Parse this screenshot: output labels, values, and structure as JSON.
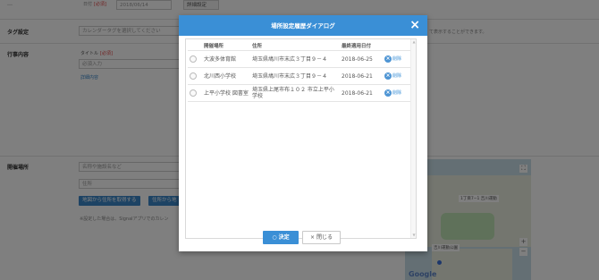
{
  "background": {
    "top_label": "日付",
    "top_required": "[必須]",
    "top_date": "2018/06/14",
    "top_button": "詳細設定",
    "tag_label": "タグ設定",
    "tag_placeholder": "カレンダータグを選択してください",
    "tag_note": "て表示することができます。",
    "event_label": "行事内容",
    "title_label": "タイトル",
    "title_required": "[必須]",
    "title_placeholder": "必須入力",
    "detail_label": "詳細内容",
    "venue_label": "開催場所",
    "venue_name_placeholder": "名称や施設名など",
    "address_placeholder": "住所",
    "address_btn": "地図から住所を取得する",
    "map_btn_partial": "住所から地",
    "venue_note": "※設定した場合は、Signalアプリでのカレン"
  },
  "map": {
    "tag1": "1丁目7−1 吉川運動",
    "tag2": "吉川運動公園",
    "logo": "Google"
  },
  "dialog": {
    "title": "場所設定履歴ダイアログ",
    "close_icon": "×",
    "columns": [
      "開催場所",
      "住所",
      "最終適用日付"
    ],
    "rows": [
      {
        "name": "大波多体育館",
        "address": "埼玉県鳩川市末広３丁目９－４",
        "date": "2018-06-25",
        "delete": "削除"
      },
      {
        "name": "北川西小学校",
        "address": "埼玉県鳩川市末広３丁目９－４",
        "date": "2018-06-21",
        "delete": "削除"
      },
      {
        "name": "上平小学校 図書室",
        "address": "埼玉県上尾市布１０２ 市立上平小学校",
        "date": "2018-06-21",
        "delete": "削除"
      }
    ],
    "ok_button": "決定",
    "cancel_button": "閉じる",
    "ok_icon": "○",
    "cancel_icon": "×"
  }
}
